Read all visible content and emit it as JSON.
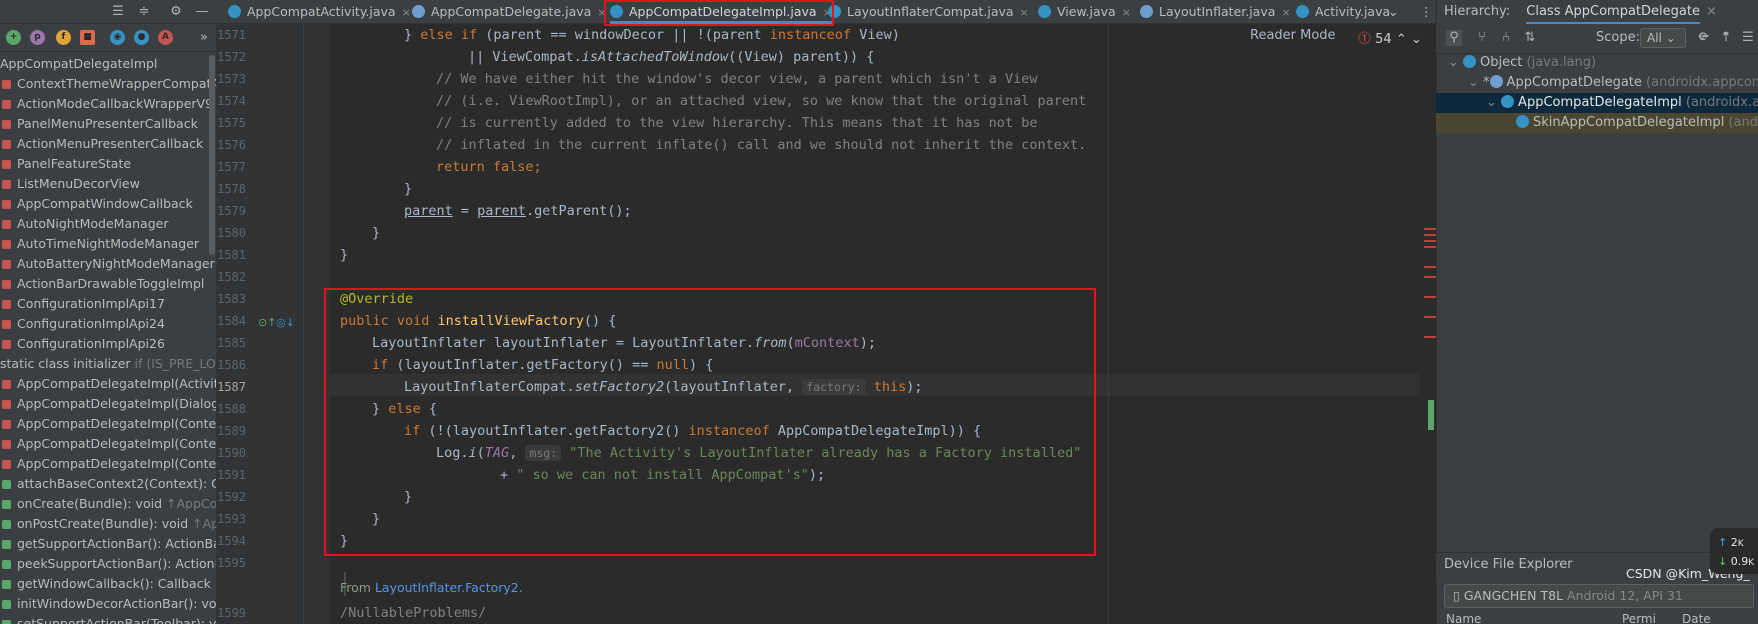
{
  "colors": {
    "keyword": "#cc7832",
    "comment": "#808080",
    "string": "#6a8759",
    "annotation": "#bbb529",
    "field": "#9876aa",
    "function": "#ffc66d",
    "highlight": "#e1141e",
    "editor_bg": "#2b2b2b",
    "panel_bg": "#3c3f41"
  },
  "left_toolbar": {
    "icons": [
      "collapse-all-icon",
      "expand-all-icon",
      "gear-icon",
      "minimize-icon"
    ]
  },
  "structure": {
    "root": "AppCompatDelegateImpl",
    "items": [
      {
        "label": "ContextThemeWrapperCompatApi",
        "extra": ""
      },
      {
        "label": "ActionModeCallbackWrapperV9",
        "extra": ""
      },
      {
        "label": "PanelMenuPresenterCallback",
        "extra": ""
      },
      {
        "label": "ActionMenuPresenterCallback",
        "extra": ""
      },
      {
        "label": "PanelFeatureState",
        "extra": ""
      },
      {
        "label": "ListMenuDecorView",
        "extra": ""
      },
      {
        "label": "AppCompatWindowCallback",
        "extra": ""
      },
      {
        "label": "AutoNightModeManager",
        "extra": ""
      },
      {
        "label": "AutoTimeNightModeManager",
        "extra": ""
      },
      {
        "label": "AutoBatteryNightModeManager",
        "extra": ""
      },
      {
        "label": "ActionBarDrawableToggleImpl",
        "extra": ""
      },
      {
        "label": "ConfigurationImplApi17",
        "extra": ""
      },
      {
        "label": "ConfigurationImplApi24",
        "extra": ""
      },
      {
        "label": "ConfigurationImplApi26",
        "extra": ""
      },
      {
        "label": "static class initializer",
        "extra": " if (IS_PRE_LOLLIP"
      },
      {
        "label": "AppCompatDelegateImpl(Activity, A",
        "extra": ""
      },
      {
        "label": "AppCompatDelegateImpl(Dialog, A",
        "extra": ""
      },
      {
        "label": "AppCompatDelegateImpl(Context,",
        "extra": ""
      },
      {
        "label": "AppCompatDelegateImpl(Context,",
        "extra": ""
      },
      {
        "label": "AppCompatDelegateImpl(Context,",
        "extra": ""
      },
      {
        "label": "attachBaseContext2(Context): Conte",
        "extra": ""
      },
      {
        "label": "onCreate(Bundle): void",
        "extra": " ↑AppComp"
      },
      {
        "label": "onPostCreate(Bundle): void",
        "extra": " ↑AppCo"
      },
      {
        "label": "getSupportActionBar(): ActionBar",
        "extra": " ↑"
      },
      {
        "label": "peekSupportActionBar(): ActionBar",
        "extra": ""
      },
      {
        "label": "getWindowCallback(): Callback",
        "extra": ""
      },
      {
        "label": "initWindowDecorActionBar(): void",
        "extra": ""
      },
      {
        "label": "setSupportActionBar(Toolbar): void",
        "extra": ""
      }
    ]
  },
  "tabs": [
    {
      "label": "AppCompatActivity.java"
    },
    {
      "label": "AppCompatDelegate.java"
    },
    {
      "label": "AppCompatDelegateImpl.java"
    },
    {
      "label": "LayoutInflaterCompat.java"
    },
    {
      "label": "View.java"
    },
    {
      "label": "LayoutInflater.java"
    },
    {
      "label": "Activity.java"
    }
  ],
  "editor": {
    "reader_mode": "Reader Mode",
    "error_count": "54",
    "line_numbers": [
      "1571",
      "1572",
      "1573",
      "1574",
      "1575",
      "1576",
      "1577",
      "1578",
      "1579",
      "1580",
      "1581",
      "1582",
      "1583",
      "1584",
      "1585",
      "1586",
      "1587",
      "1588",
      "1589",
      "1590",
      "1591",
      "1592",
      "1593",
      "1594",
      "1595",
      "1599"
    ],
    "code": {
      "l1571a": "} ",
      "l1571b": "else if",
      " l1571c": "",
      "l1571": " (parent == windowDecor || !(parent ",
      "l1571kw2": "instanceof",
      "l1571end": " View)",
      "l1572a": "|| ViewCompat.",
      "l1572b": "isAttachedToWindow",
      "l1572c": "((View) parent)) {",
      "c1573": "// We have either hit the window's decor view, a parent which isn't a View",
      "c1574": "// (i.e. ViewRootImpl), or an attached view, so we know that the original parent",
      "c1575": "// is currently added to the view hierarchy. This means that it has not be",
      "c1576": "// inflated in the current inflate() call and we should not inherit the context.",
      "r1577a": "return false",
      "r1577b": ";",
      "b1578": "}",
      "p1579a": "parent",
      "p1579b": " = ",
      "p1579c": "parent",
      "p1579d": ".getParent();",
      "b1580": "}",
      "b1581": "}",
      "ann1583": "@Override",
      "s1584a": "public void ",
      "s1584b": "installViewFactory",
      "s1584c": "() {",
      "s1585a": "LayoutInflater layoutInflater = LayoutInflater.",
      "s1585b": "from",
      "s1585c": "(",
      "s1585d": "mContext",
      "s1585e": ");",
      "s1586a": "if ",
      "s1586b": "(layoutInflater.getFactory() == ",
      "s1586c": "null",
      "s1586d": ") {",
      "s1587a": "LayoutInflaterCompat.",
      "s1587b": "setFactory2",
      "s1587c": "(layoutInflater, ",
      "s1587hint": "factory:",
      "s1587d": " this",
      "s1587e": ");",
      "s1588a": "} ",
      "s1588b": "else",
      " s1588c": "",
      "s1588end": " {",
      "s1589a": "if ",
      "s1589b": "(!(layoutInflater.getFactory2() ",
      "s1589c": "instanceof",
      "s1589d": " AppCompatDelegateImpl)) {",
      "s1590a": "Log.",
      "s1590b": "i",
      "s1590c": "(",
      "s1590d": "TAG",
      ", s1590e": "",
      "s1590comma": ", ",
      "s1590hint": "msg:",
      "s1590str": " \"The Activity's LayoutInflater already has a Factory installed\"",
      "s1591a": "+ ",
      "s1591str": "\" so we can not install AppCompat's\"",
      "s1591b": ");",
      "b1592": "}",
      "b1593": "}",
      "b1594": "}",
      "from_label": "From ",
      "from_link": "LayoutInflater.Factory2.",
      "s1599": "/NullableProblems/"
    }
  },
  "hierarchy": {
    "label": "Hierarchy:",
    "class_tab": "Class AppCompatDelegate",
    "scope_label": "Scope:",
    "scope_value": "All",
    "rows": [
      {
        "name": "Object",
        "pkg": " (java.lang)"
      },
      {
        "name": "AppCompatDelegate",
        "pkg": " (androidx.appcom"
      },
      {
        "name": "AppCompatDelegateImpl",
        "pkg": " (androidx.ap"
      },
      {
        "name": "SkinAppCompatDelegateImpl",
        "pkg": " (andr"
      }
    ]
  },
  "device_explorer": {
    "title": "Device File Explorer",
    "device": "GANGCHEN T8L",
    "device_sub": " Android 12, API 31",
    "col_name": "Name",
    "col_perm": "Permi",
    "col_date": "Date"
  },
  "overlay": {
    "watermark": "CSDN @Kim_Weng_",
    "up_rate": "2",
    "up_unit": "K",
    "down_rate": "0.9",
    "down_unit": "K"
  }
}
